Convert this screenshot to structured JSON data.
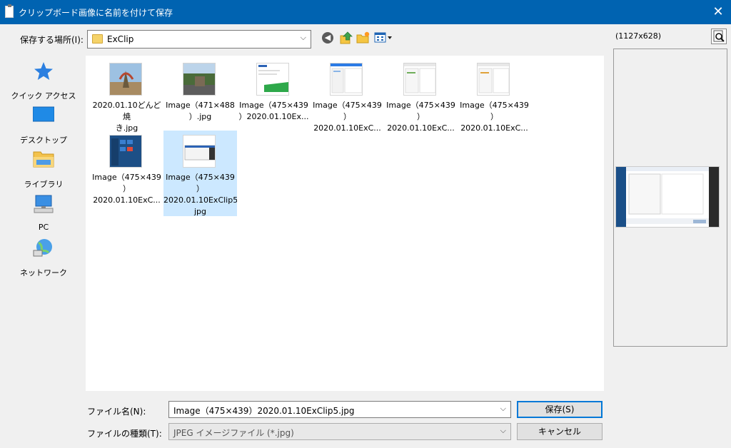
{
  "window": {
    "title": "クリップボード画像に名前を付けて保存",
    "close_glyph": "✕"
  },
  "location": {
    "label": "保存する場所(I):",
    "value": "ExClip",
    "dropdown_glyph": "⌵"
  },
  "toolbar": {
    "back_glyph": "◀"
  },
  "preview": {
    "size_label": "(1127x628)"
  },
  "places": [
    {
      "label": "クイック アクセス",
      "icon": "star-icon"
    },
    {
      "label": "デスクトップ",
      "icon": "desktop-icon"
    },
    {
      "label": "ライブラリ",
      "icon": "library-folder-icon"
    },
    {
      "label": "PC",
      "icon": "computer-icon"
    },
    {
      "label": "ネットワーク",
      "icon": "network-icon"
    }
  ],
  "files": [
    {
      "line1": "2020.01.10どんど焼",
      "line2": "き.jpg",
      "line3": "",
      "line4": "",
      "selected": false
    },
    {
      "line1": "Image（471×488",
      "line2": "）.jpg",
      "line3": "",
      "line4": "",
      "selected": false
    },
    {
      "line1": "Image（475×439",
      "line2": "）2020.01.10Ex...",
      "line3": "",
      "line4": "",
      "selected": false
    },
    {
      "line1": "Image（475×439",
      "line2": "）2020.01.10ExC...",
      "line3": "",
      "line4": "",
      "selected": false
    },
    {
      "line1": "Image（475×439",
      "line2": "）2020.01.10ExC...",
      "line3": "",
      "line4": "",
      "selected": false
    },
    {
      "line1": "Image（475×439",
      "line2": "）2020.01.10ExC...",
      "line3": "",
      "line4": "",
      "selected": false
    },
    {
      "line1": "Image（475×439",
      "line2": "）2020.01.10ExC...",
      "line3": "",
      "line4": "",
      "selected": false
    },
    {
      "line1": "Image（475×439",
      "line2": "）",
      "line3": "2020.01.10ExClip5.",
      "line4": "jpg",
      "selected": true
    }
  ],
  "filename": {
    "label": "ファイル名(N):",
    "value": "Image（475×439）2020.01.10ExClip5.jpg",
    "dropdown_glyph": "⌵"
  },
  "filetype": {
    "label": "ファイルの種類(T):",
    "value": "JPEG イメージファイル (*.jpg)",
    "dropdown_glyph": "⌵"
  },
  "buttons": {
    "save": "保存(S)",
    "cancel": "キャンセル"
  }
}
